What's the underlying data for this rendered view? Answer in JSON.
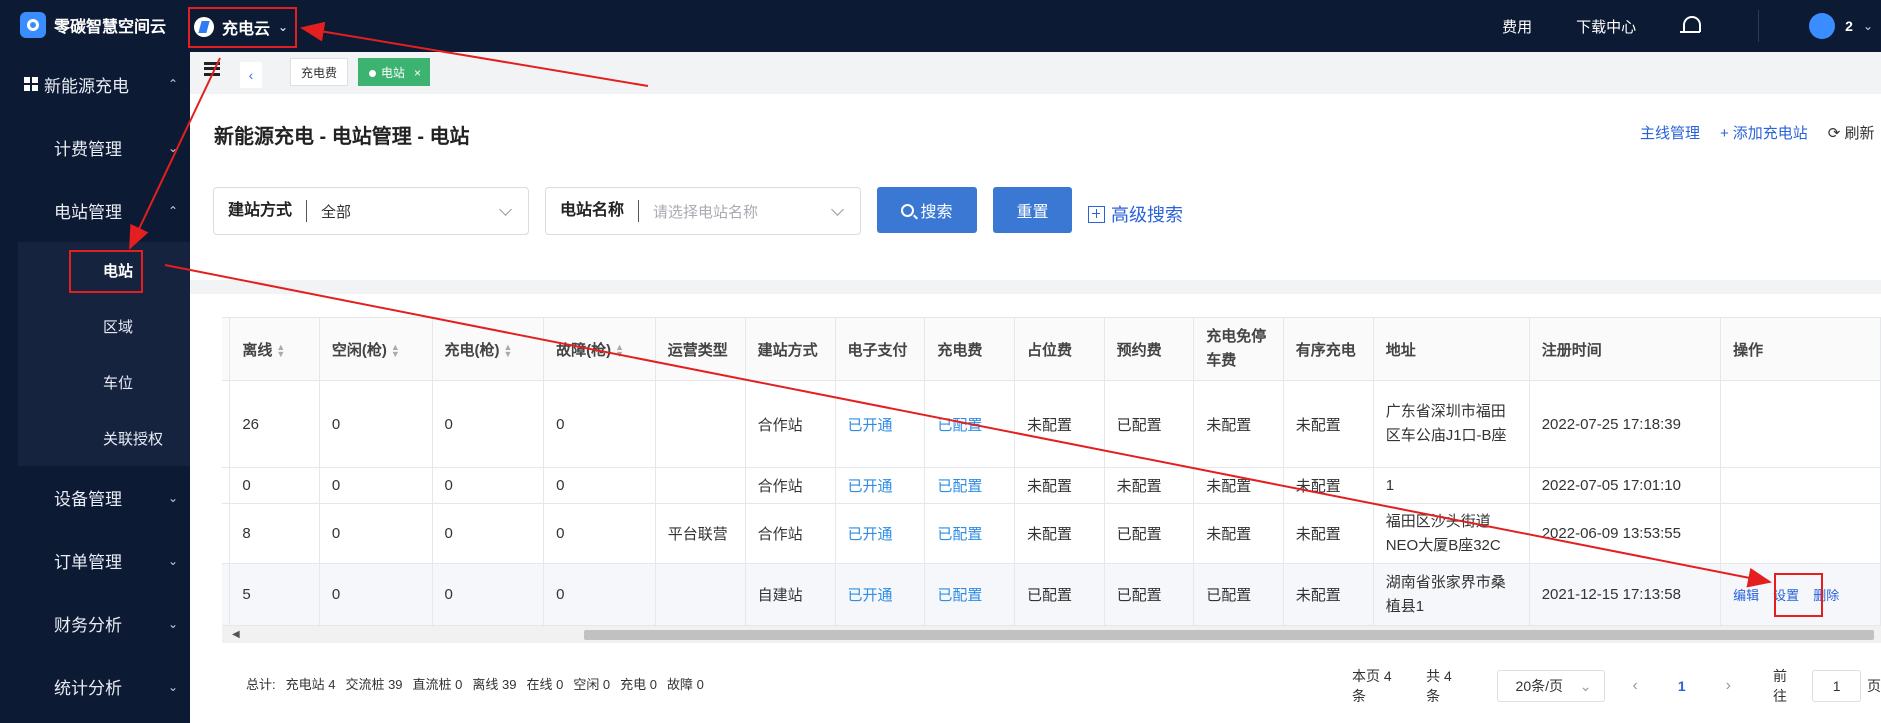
{
  "topbar": {
    "brand": "零碳智慧空间云",
    "app_name": "充电云",
    "links": [
      "费用",
      "下载中心"
    ],
    "user_count": "2"
  },
  "sidebar": {
    "group_title": "新能源充电",
    "items": [
      {
        "label": "计费管理",
        "expanded": false
      },
      {
        "label": "电站管理",
        "expanded": true,
        "children": [
          "电站",
          "区域",
          "车位",
          "关联授权"
        ]
      },
      {
        "label": "设备管理",
        "expanded": false
      },
      {
        "label": "订单管理",
        "expanded": false
      },
      {
        "label": "财务分析",
        "expanded": false
      },
      {
        "label": "统计分析",
        "expanded": false
      }
    ],
    "active_child": "电站"
  },
  "tabs": [
    {
      "label": "充电费",
      "active": false
    },
    {
      "label": "电站",
      "active": true,
      "close": "×"
    }
  ],
  "header": {
    "title": "新能源充电 - 电站管理 - 电站",
    "actions": [
      "主线管理",
      "添加充电站",
      "刷新"
    ]
  },
  "filters": {
    "build_mode": {
      "label": "建站方式",
      "value": "全部"
    },
    "station_name": {
      "label": "电站名称",
      "placeholder": "请选择电站名称"
    },
    "search_label": "搜索",
    "reset_label": "重置",
    "advanced_label": "高级搜索"
  },
  "table": {
    "columns": [
      "离线",
      "空闲(枪)",
      "充电(枪)",
      "故障(枪)",
      "运营类型",
      "建站方式",
      "电子支付",
      "充电费",
      "占位费",
      "预约费",
      "充电免停车费",
      "有序充电",
      "地址",
      "注册时间",
      "操作"
    ],
    "rows": [
      {
        "cells": [
          "26",
          "0",
          "0",
          "0",
          "",
          "合作站",
          "已开通",
          "已配置",
          "未配置",
          "已配置",
          "未配置",
          "未配置",
          "广东省深圳市福田区车公庙J1口-B座",
          "2022-07-25 17:18:39"
        ],
        "ops": []
      },
      {
        "cells": [
          "0",
          "0",
          "0",
          "0",
          "",
          "合作站",
          "已开通",
          "已配置",
          "未配置",
          "未配置",
          "未配置",
          "未配置",
          "1",
          "2022-07-05 17:01:10"
        ],
        "ops": []
      },
      {
        "cells": [
          "8",
          "0",
          "0",
          "0",
          "平台联营",
          "合作站",
          "已开通",
          "已配置",
          "未配置",
          "已配置",
          "未配置",
          "未配置",
          "福田区沙头街道NEO大厦B座32C",
          "2022-06-09 13:53:55"
        ],
        "ops": []
      },
      {
        "cells": [
          "5",
          "0",
          "0",
          "0",
          "",
          "自建站",
          "已开通",
          "已配置",
          "已配置",
          "已配置",
          "已配置",
          "未配置",
          "湖南省张家界市桑植县1",
          "2021-12-15 17:13:58"
        ],
        "ops": [
          "编辑",
          "设置",
          "删除"
        ]
      }
    ]
  },
  "summary": [
    "总计:",
    "充电站 4",
    "交流桩 39",
    "直流桩 0",
    "离线 39",
    "在线 0",
    "空闲 0",
    "充电 0",
    "故障 0"
  ],
  "pagination": {
    "page_count_text": "本页 4 条",
    "total_text": "共 4 条",
    "page_size": "20条/页",
    "current_page": "1",
    "goto_label": "前往",
    "goto_value": "1",
    "goto_suffix": "页"
  },
  "annotation_color": "#e41f1f"
}
